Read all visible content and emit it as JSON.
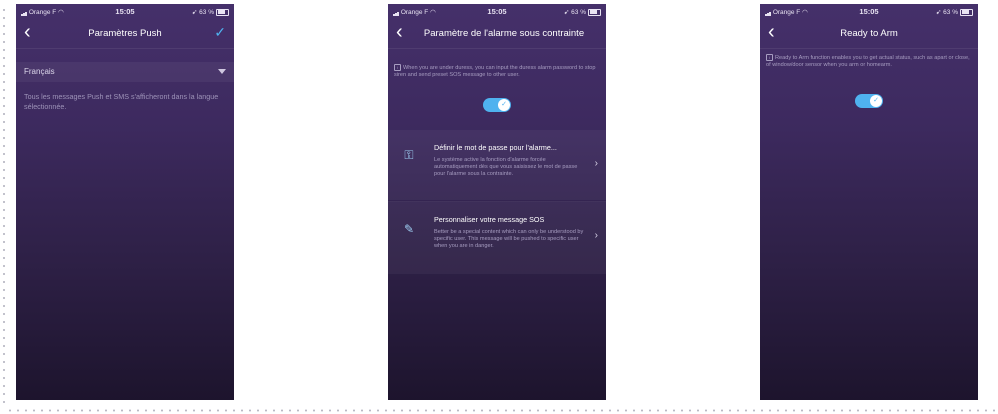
{
  "status": {
    "carrier": "Orange F",
    "time": "15:05",
    "battery": "63 %"
  },
  "screen_push": {
    "title": "Paramètres Push",
    "language": "Français",
    "description": "Tous les messages Push et SMS s'afficheront dans la langue sélectionnée."
  },
  "screen_duress": {
    "title": "Paramètre de l'alarme sous contrainte",
    "info": "When you are under duress, you can input the duress alarm password to stop siren and send preset SOS message to other user.",
    "toggle_on": true,
    "sections": [
      {
        "icon": "key-icon",
        "title": "Définir le mot de passe pour l'alarme...",
        "description": "Le système active la fonction d'alarme forcée automatiquement dès que vous saisissez le mot de passe pour l'alarme sous la contrainte."
      },
      {
        "icon": "edit-message-icon",
        "title": "Personnaliser votre message SOS",
        "description": "Better be a special content which can only be understood by specific user. This message will be pushed to specific user when you are in danger."
      }
    ]
  },
  "screen_ready": {
    "title": "Ready to Arm",
    "info": "Ready to Arm function enables you to get actual status, such as apart or close, of window/door sensor when you arm or homearm.",
    "toggle_on": true
  },
  "colors": {
    "accent": "#4fb2ef",
    "background_top": "#45306a",
    "background_bottom": "#1d142d"
  }
}
